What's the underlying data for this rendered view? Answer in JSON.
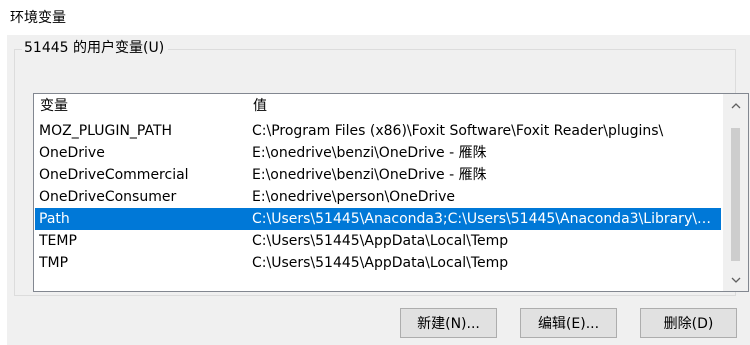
{
  "window": {
    "title": "环境变量"
  },
  "user_variables": {
    "group_label": "51445 的用户变量(U)",
    "columns": {
      "name": "变量",
      "value": "值"
    },
    "rows": [
      {
        "name": "MOZ_PLUGIN_PATH",
        "value": "C:\\Program Files (x86)\\Foxit Software\\Foxit Reader\\plugins\\",
        "selected": false
      },
      {
        "name": "OneDrive",
        "value": "E:\\onedrive\\benzi\\OneDrive - 雁陎",
        "selected": false
      },
      {
        "name": "OneDriveCommercial",
        "value": "E:\\onedrive\\benzi\\OneDrive - 雁陎",
        "selected": false
      },
      {
        "name": "OneDriveConsumer",
        "value": "E:\\onedrive\\person\\OneDrive",
        "selected": false
      },
      {
        "name": "Path",
        "value": "C:\\Users\\51445\\Anaconda3;C:\\Users\\51445\\Anaconda3\\Library\\m...",
        "selected": true
      },
      {
        "name": "TEMP",
        "value": "C:\\Users\\51445\\AppData\\Local\\Temp",
        "selected": false
      },
      {
        "name": "TMP",
        "value": "C:\\Users\\51445\\AppData\\Local\\Temp",
        "selected": false
      }
    ],
    "scrollbar": {
      "up_icon": "chevron-up-icon",
      "down_icon": "chevron-down-icon"
    }
  },
  "buttons": {
    "new_label": "新建(N)...",
    "edit_label": "编辑(E)...",
    "delete_label": "删除(D)"
  },
  "colors": {
    "selection": "#0078d7",
    "panel": "#f0f0f0",
    "button_face": "#e1e1e1"
  }
}
